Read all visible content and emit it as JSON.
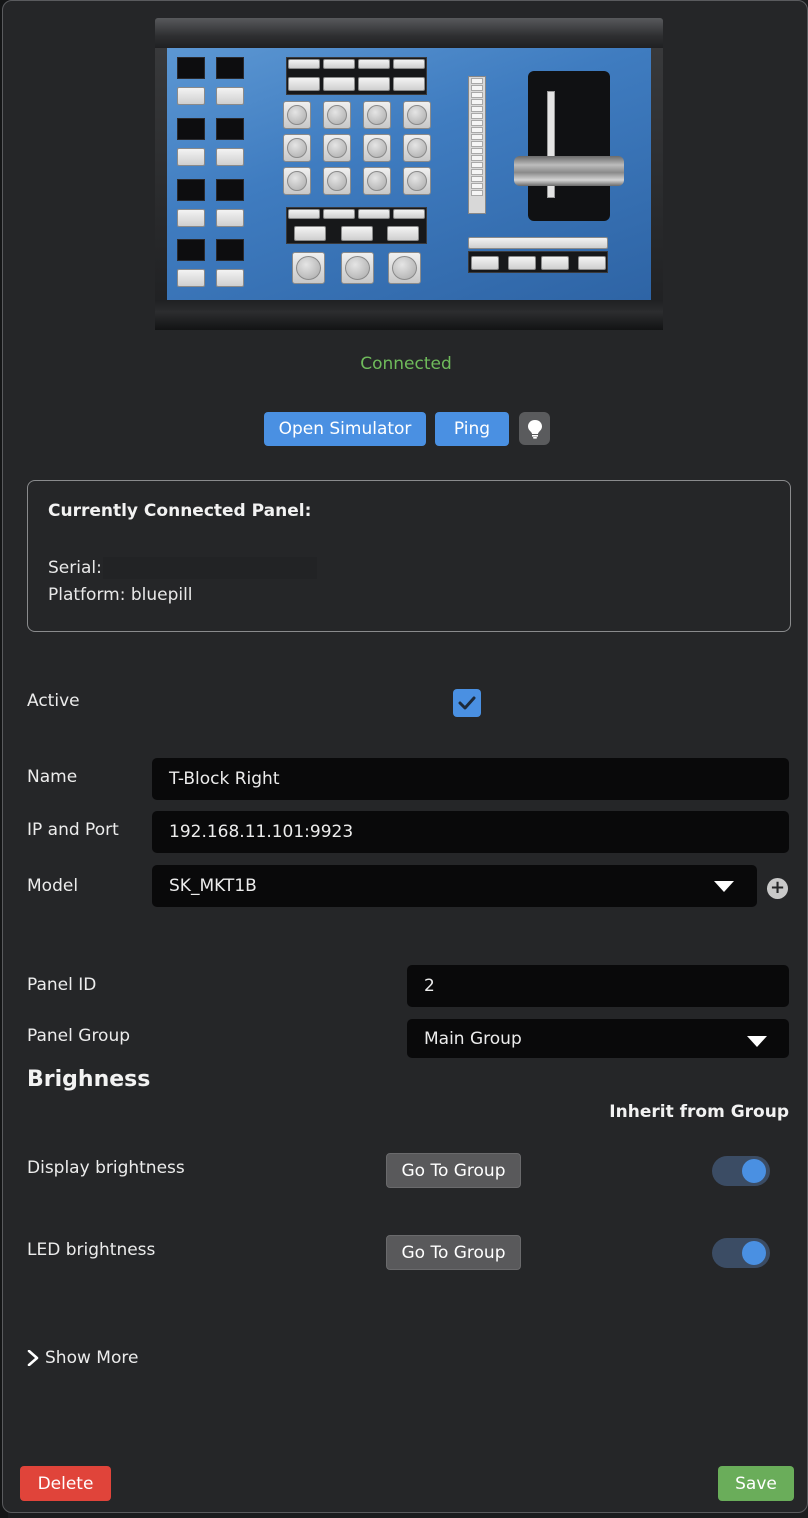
{
  "status": {
    "text": "Connected",
    "color": "#6fbb5b"
  },
  "toolbar": {
    "open_simulator_label": "Open Simulator",
    "ping_label": "Ping",
    "identify_icon": "lightbulb-icon"
  },
  "connected_panel": {
    "title": "Currently Connected Panel:",
    "serial_label": "Serial:",
    "serial_value": "",
    "platform_text": "Platform: bluepill"
  },
  "form": {
    "active_label": "Active",
    "active_checked": true,
    "name_label": "Name",
    "name_value": "T-Block Right",
    "ip_label": "IP and Port",
    "ip_value": "192.168.11.101:9923",
    "model_label": "Model",
    "model_value": "SK_MKT1B",
    "panel_id_label": "Panel ID",
    "panel_id_value": "2",
    "panel_group_label": "Panel Group",
    "panel_group_value": "Main Group"
  },
  "brightness": {
    "section_title": "Brighness",
    "inherit_header": "Inherit from Group",
    "rows": [
      {
        "label": "Display brightness",
        "button_label": "Go To Group",
        "inherit_on": true
      },
      {
        "label": "LED brightness",
        "button_label": "Go To Group",
        "inherit_on": true
      }
    ]
  },
  "show_more_label": "Show More",
  "footer": {
    "delete_label": "Delete",
    "save_label": "Save"
  },
  "colors": {
    "accent": "#4a90e2",
    "danger": "#e0443a",
    "success": "#6aad5a",
    "panel_face": "#3f7cc0"
  }
}
